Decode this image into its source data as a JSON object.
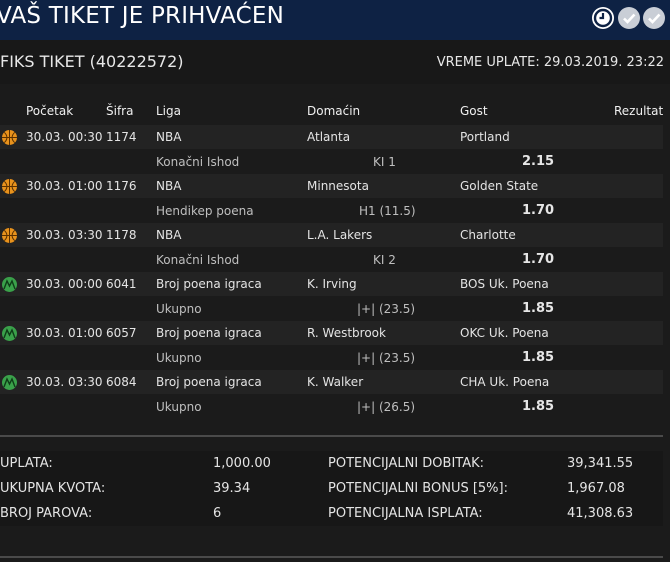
{
  "window": {
    "title": "VAŠ TIKET JE PRIHVAĆEN"
  },
  "ticket": {
    "title": "FIKS TIKET (40222572)",
    "payment_time": "VREME UPLATE: 29.03.2019. 23:22"
  },
  "columns": {
    "start": "Početak",
    "code": "Šifra",
    "league": "Liga",
    "home": "Domaćin",
    "away": "Gost",
    "result": "Rezultat"
  },
  "matches": [
    {
      "sport_icon": "basketball-icon",
      "start": "30.03. 00:30",
      "code": "1174",
      "league": "NBA",
      "home": "Atlanta",
      "away": "Portland",
      "bet_type": "Konačni Ishod",
      "pick": "KI 1",
      "odds": "2.15"
    },
    {
      "sport_icon": "basketball-icon",
      "start": "30.03. 01:00",
      "code": "1176",
      "league": "NBA",
      "home": "Minnesota",
      "away": "Golden State",
      "bet_type": "Hendikep poena",
      "pick": "H1 (11.5)",
      "odds": "1.70"
    },
    {
      "sport_icon": "basketball-icon",
      "start": "30.03. 03:30",
      "code": "1178",
      "league": "NBA",
      "home": "L.A. Lakers",
      "away": "Charlotte",
      "bet_type": "Konačni Ishod",
      "pick": "KI 2",
      "odds": "1.70"
    },
    {
      "sport_icon": "player-stats-icon",
      "start": "30.03. 00:00",
      "code": "6041",
      "league": "Broj poena igraca",
      "home": "K. Irving",
      "away": "BOS Uk. Poena",
      "bet_type": "Ukupno",
      "pick": "|+| (23.5)",
      "odds": "1.85"
    },
    {
      "sport_icon": "player-stats-icon",
      "start": "30.03. 01:00",
      "code": "6057",
      "league": "Broj poena igraca",
      "home": "R. Westbrook",
      "away": "OKC Uk. Poena",
      "bet_type": "Ukupno",
      "pick": "|+| (23.5)",
      "odds": "1.85"
    },
    {
      "sport_icon": "player-stats-icon",
      "start": "30.03. 03:30",
      "code": "6084",
      "league": "Broj poena igraca",
      "home": "K. Walker",
      "away": "CHA Uk. Poena",
      "bet_type": "Ukupno",
      "pick": "|+| (26.5)",
      "odds": "1.85"
    }
  ],
  "summary": {
    "stake_label": "UPLATA:",
    "stake_value": "1,000.00",
    "total_odds_label": "UKUPNA KVOTA:",
    "total_odds_value": "39.34",
    "pairs_label": "BROJ PAROVA:",
    "pairs_value": "6",
    "potential_win_label": "POTENCIJALNI DOBITAK:",
    "potential_win_value": "39,341.55",
    "bonus_label": "POTENCIJALNI BONUS [5%]:",
    "bonus_value": "1,967.08",
    "payout_label": "POTENCIJALNA ISPLATA:",
    "payout_value": "41,308.63"
  },
  "colors": {
    "titlebar": "#0e2244",
    "background": "#1b1b1b",
    "basketball": "#e8921c",
    "player_stats": "#3aa14a"
  }
}
